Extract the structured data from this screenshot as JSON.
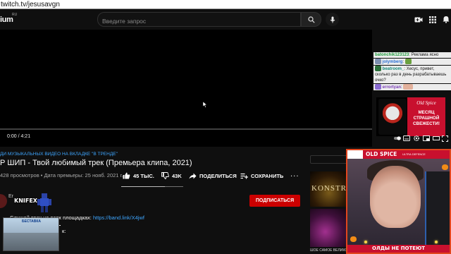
{
  "browser": {
    "url": "twitch.tv/jesusavgn"
  },
  "header": {
    "logo_text": "ium",
    "logo_sup": "RU",
    "search_placeholder": "Введите запрос",
    "icons": [
      "search-icon",
      "mic-icon",
      "create-video-icon",
      "apps-icon",
      "notifications-icon"
    ]
  },
  "video": {
    "time": "0:00 / 4:21",
    "progress": 0
  },
  "chat": {
    "messages": [
      {
        "user": "batonchik123123",
        "text": "Реклама ясно"
      },
      {
        "user": "jolymberg",
        "text": ""
      },
      {
        "user": "beatroom_",
        "text": "Хесус, привет, сколько раз в день разрабатываешь очко?"
      },
      {
        "user": "errortyan",
        "text": ""
      }
    ]
  },
  "ad": {
    "brand": "Old Spice",
    "text": "МЕСЯЦ СТРАШНОЙ СВЕЖЕСТИ!"
  },
  "details": {
    "hashtag": "ДИ МУЗЫКАЛЬНЫХ ВИДЕО НА ВКЛАДКЕ \"В ТРЕНДЕ\"",
    "title": "Р ШИП - Твой любимый трек (Премьера клипа, 2021)",
    "meta": "428 просмотров • Дата премьеры: 25 нояб. 2021 г.",
    "likes": "45 ТЫС.",
    "dislikes": "43K",
    "share_label": "ПОДЕЛИТЬСЯ",
    "save_label": "СОХРАНИТЬ",
    "more_label": "...",
    "channel_name": "Er",
    "subscribe_label": "ПОДПИСАТЬСЯ",
    "description_prefix": "Слушай трек на всех площадках:",
    "description_link": "https://band.link/X4jwf",
    "description_more": "к:"
  },
  "overlays": {
    "knifex": "KNIFEX",
    "mini_video_label": "БЕСТАВКА"
  },
  "related": {
    "thumb1_text": "KONSTR",
    "caption": "ШОЕ САМОЕ ВЕЛИКОЕ И..."
  },
  "webcam": {
    "brand": "OLD SPICE",
    "brand_sub": "ULTRA DEFENCE",
    "bottom_text": "ОЛДЫ НЕ ПОТЕЮТ"
  },
  "colors": {
    "accent_red": "#cc0000",
    "link_blue": "#3ea6ff",
    "oldspice_red": "#c8102e",
    "webcam_border": "#e2461e"
  }
}
